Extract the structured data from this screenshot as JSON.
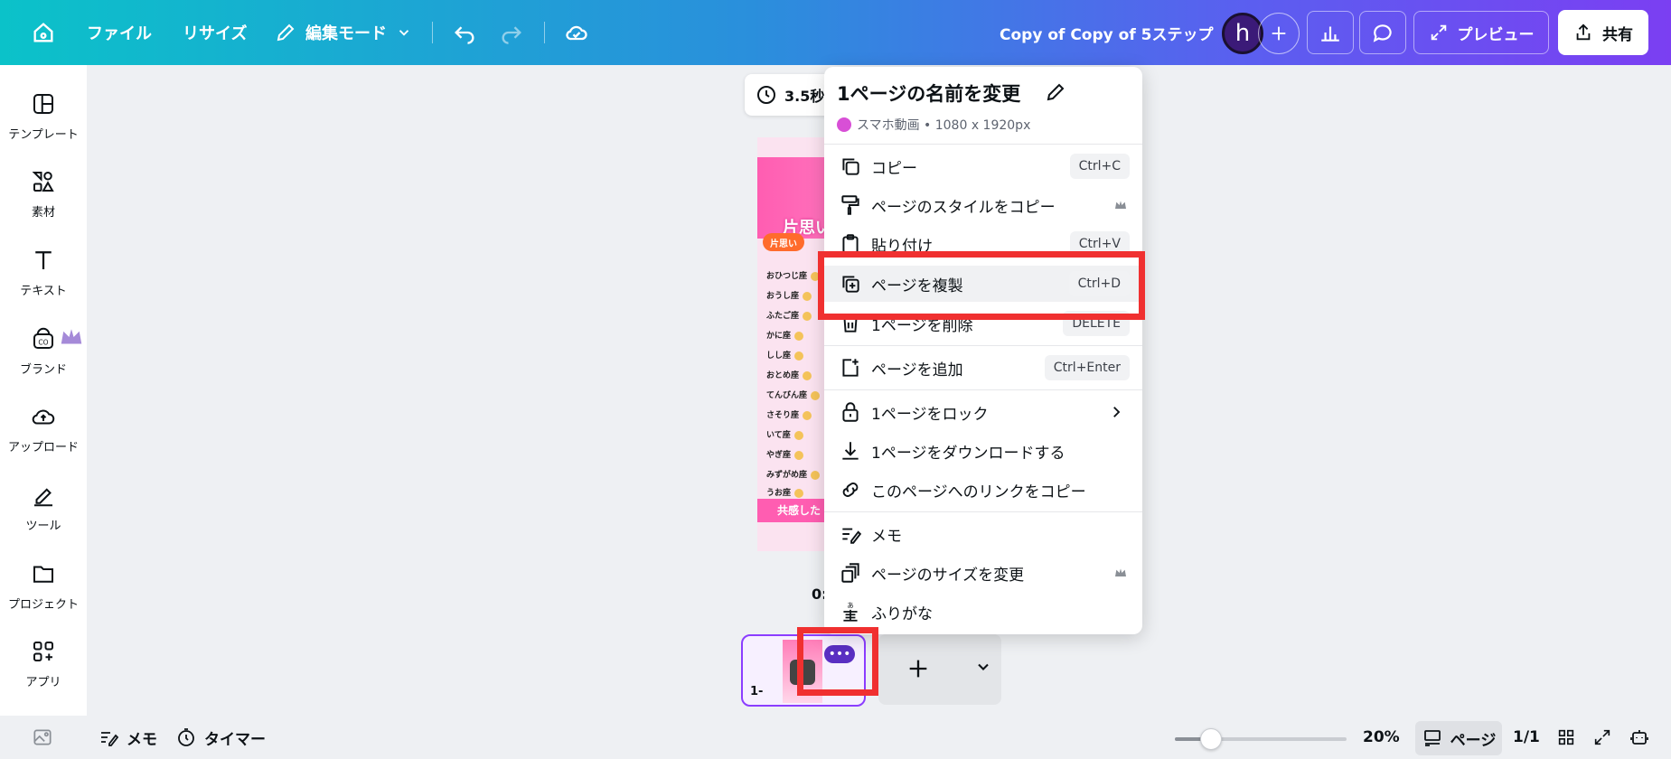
{
  "topbar": {
    "file": "ファイル",
    "resize": "リサイズ",
    "edit_mode": "編集モード",
    "doc_title": "Copy of Copy of 5ステップ",
    "avatar_letter": "h",
    "preview": "プレビュー",
    "share": "共有"
  },
  "sidebar": {
    "items": [
      {
        "label": "テンプレート",
        "icon": "template-icon"
      },
      {
        "label": "素材",
        "icon": "elements-icon"
      },
      {
        "label": "テキスト",
        "icon": "text-icon"
      },
      {
        "label": "ブランド",
        "icon": "brand-icon"
      },
      {
        "label": "アップロード",
        "icon": "upload-icon"
      },
      {
        "label": "ツール",
        "icon": "tools-icon"
      },
      {
        "label": "プロジェクト",
        "icon": "projects-icon"
      },
      {
        "label": "アプリ",
        "icon": "apps-icon"
      }
    ]
  },
  "canvas": {
    "duration": "3.5秒",
    "time_label": "0:",
    "design_heading": "片思い",
    "design_tag": "片思い",
    "design_rows": [
      "おひつじ座",
      "おうし座",
      "ふたご座",
      "かに座",
      "しし座",
      "おとめ座",
      "てんびん座",
      "さそり座",
      "いて座",
      "やぎ座",
      "みずがめ座",
      "うお座"
    ],
    "design_footer": "共感した"
  },
  "thumbnail": {
    "number": "1-",
    "more": "•••"
  },
  "menu": {
    "title": "1ページの名前を変更",
    "subtitle": "スマホ動画 • 1080 x 1920px",
    "items": [
      {
        "label": "コピー",
        "shortcut": "Ctrl+C",
        "icon": "copy-icon"
      },
      {
        "label": "ページのスタイルをコピー",
        "shortcut": "",
        "icon": "paint-roller-icon",
        "premium": true
      },
      {
        "label": "貼り付け",
        "shortcut": "Ctrl+V",
        "icon": "paste-icon"
      },
      {
        "label": "ページを複製",
        "shortcut": "Ctrl+D",
        "icon": "duplicate-icon"
      },
      {
        "label": "1ページを削除",
        "shortcut": "DELETE",
        "icon": "trash-icon"
      },
      {
        "label": "ページを追加",
        "shortcut": "Ctrl+Enter",
        "icon": "add-page-icon"
      },
      {
        "label": "1ページをロック",
        "shortcut": "",
        "icon": "lock-icon"
      },
      {
        "label": "1ページをダウンロードする",
        "shortcut": "",
        "icon": "download-icon"
      },
      {
        "label": "このページへのリンクをコピー",
        "shortcut": "",
        "icon": "link-icon"
      },
      {
        "label": "メモ",
        "shortcut": "",
        "icon": "notes-icon"
      },
      {
        "label": "ページのサイズを変更",
        "shortcut": "",
        "icon": "resize-page-icon",
        "premium": true
      },
      {
        "label": "ふりがな",
        "shortcut": "",
        "icon": "furigana-icon"
      }
    ]
  },
  "bottombar": {
    "notes": "メモ",
    "timer": "タイマー",
    "zoom": "20%",
    "zoom_fraction": 0.2,
    "pages": "ページ",
    "page_count": "1/1"
  },
  "colors": {
    "accent": "#8b3dff",
    "highlight": "#f03030"
  }
}
